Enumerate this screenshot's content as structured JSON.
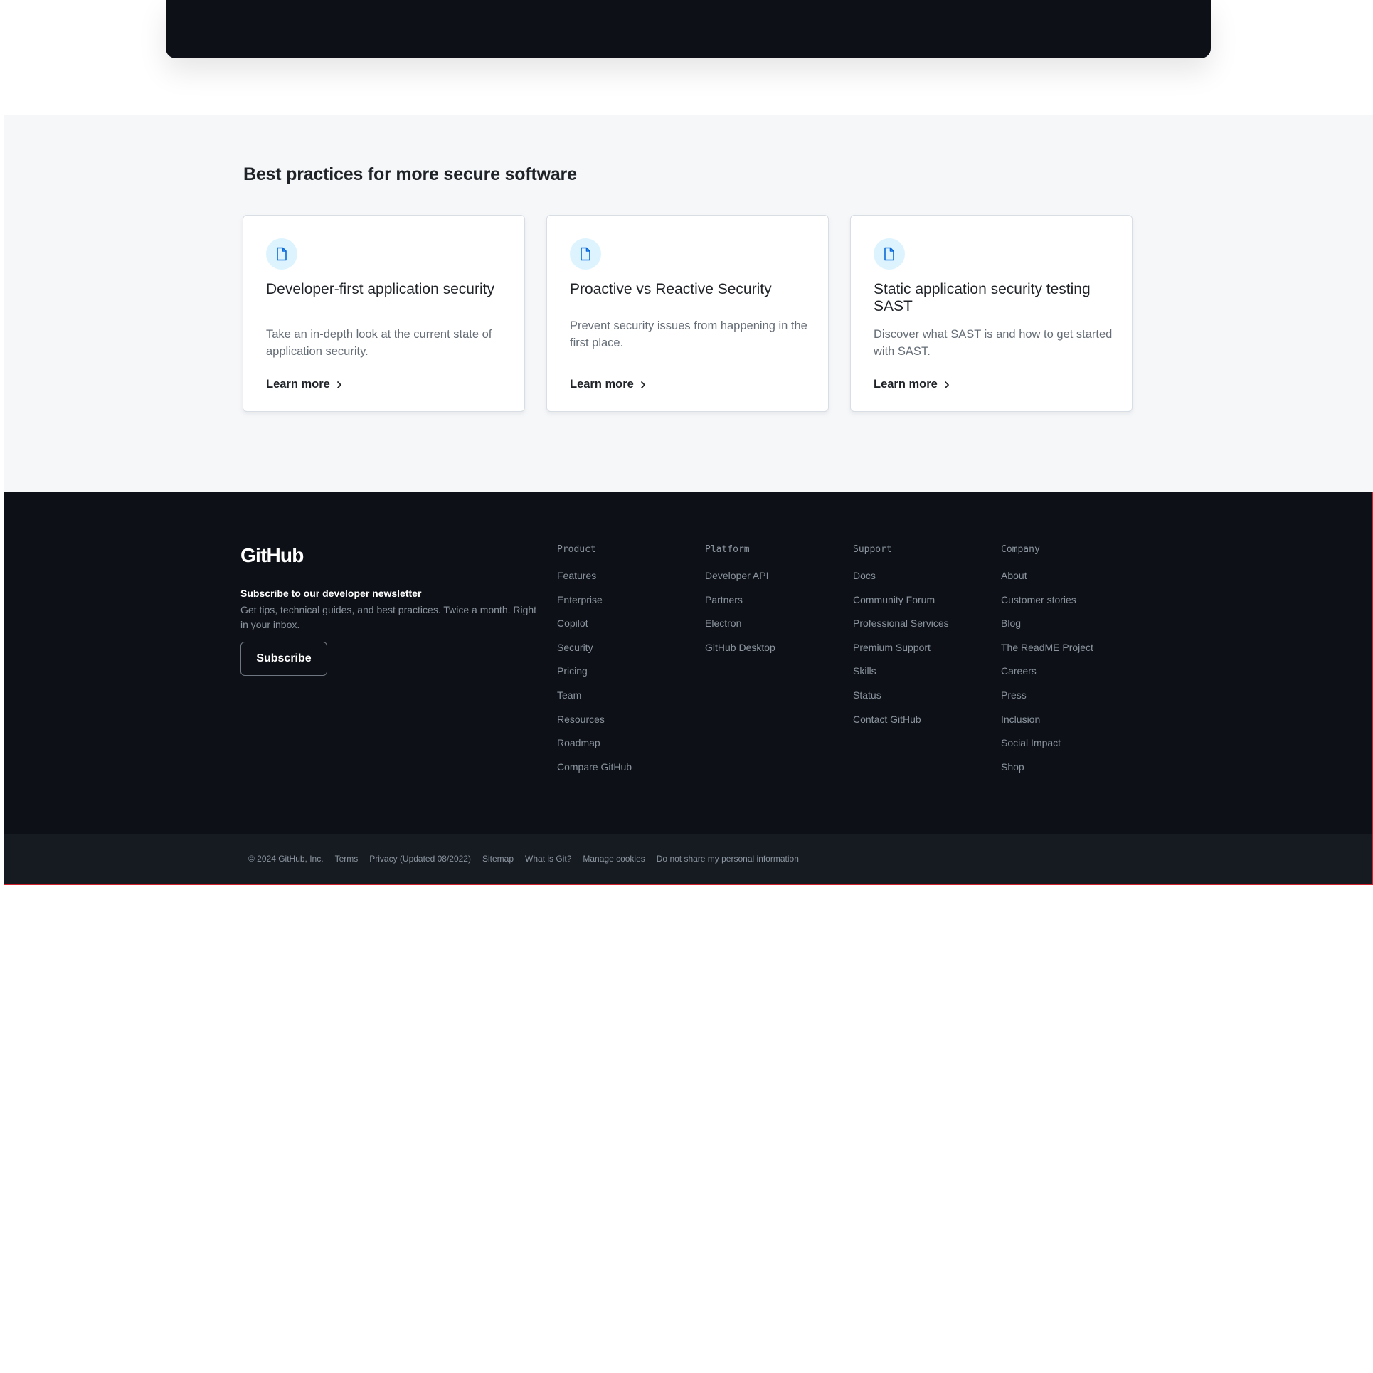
{
  "practices": {
    "title": "Best practices for more secure software",
    "cards": [
      {
        "icon": "file-icon",
        "title": "Developer-first application security",
        "description": "Take an in-depth look at the current state of application security.",
        "link": "Learn more"
      },
      {
        "icon": "file-icon",
        "title": "Proactive vs Reactive Security",
        "description": "Prevent security issues from happening in the first place.",
        "link": "Learn more"
      },
      {
        "icon": "file-icon",
        "title": "Static application security testing SAST",
        "description": "Discover what SAST is and how to get started with SAST.",
        "link": "Learn more"
      }
    ]
  },
  "footer": {
    "logo": "GitHub",
    "newsletter": {
      "title": "Subscribe to our developer newsletter",
      "description": "Get tips, technical guides, and best practices. Twice a month. Right in your inbox.",
      "button": "Subscribe"
    },
    "columns": [
      {
        "heading": "Product",
        "items": [
          "Features",
          "Enterprise",
          "Copilot",
          "Security",
          "Pricing",
          "Team",
          "Resources",
          "Roadmap",
          "Compare GitHub"
        ]
      },
      {
        "heading": "Platform",
        "items": [
          "Developer API",
          "Partners",
          "Electron",
          "GitHub Desktop"
        ]
      },
      {
        "heading": "Support",
        "items": [
          "Docs",
          "Community Forum",
          "Professional Services",
          "Premium Support",
          "Skills",
          "Status",
          "Contact GitHub"
        ]
      },
      {
        "heading": "Company",
        "items": [
          "About",
          "Customer stories",
          "Blog",
          "The ReadME Project",
          "Careers",
          "Press",
          "Inclusion",
          "Social Impact",
          "Shop"
        ]
      }
    ],
    "legal": {
      "copyright": "© 2024 GitHub, Inc.",
      "links": [
        "Terms",
        "Privacy (Updated 08/2022)",
        "Sitemap",
        "What is Git?",
        "Manage cookies",
        "Do not share my personal information"
      ]
    }
  },
  "colors": {
    "dark_bg": "#0d1117",
    "footer_bottom_bg": "#161b22",
    "section_bg": "#f6f7f9",
    "icon_circle": "#ddf4ff",
    "icon_stroke": "#0969da",
    "footer_border": "#cf222e"
  }
}
